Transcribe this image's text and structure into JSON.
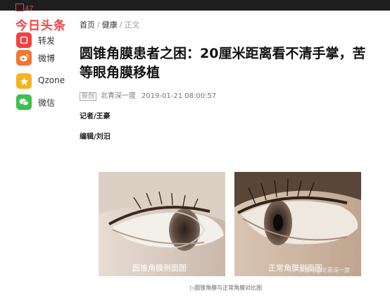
{
  "header": {
    "badge_count": "47",
    "brand": "今日头条"
  },
  "share": {
    "items": [
      {
        "label": "转发",
        "icon": "repost-icon",
        "color": "#f04142"
      },
      {
        "label": "微博",
        "icon": "weibo-icon",
        "color": "#f5762e"
      },
      {
        "label": "Qzone",
        "icon": "qzone-icon",
        "color": "#f5b41d"
      },
      {
        "label": "微信",
        "icon": "wechat-icon",
        "color": "#3cbf4c"
      }
    ]
  },
  "breadcrumb": {
    "home": "首页",
    "category": "健康",
    "current": "正文",
    "separator": "/"
  },
  "article": {
    "title": "圆锥角膜患者之困：20厘米距离看不清手掌，苦等眼角膜移植",
    "original_tag": "原创",
    "source": "北青深一度",
    "date": "2019-01-21 08:00:57",
    "reporter": "记者/王豪",
    "editor": "编辑/刘汨"
  },
  "figure": {
    "left_label": "圆锥角膜侧面图",
    "right_label": "正常角膜侧面图",
    "watermark": "头条号@北青深一度",
    "caption": "▷圆锥角膜与正常角膜对比图"
  },
  "colors": {
    "brand_red": "#f04142",
    "topbar": "#1e1e1e"
  }
}
